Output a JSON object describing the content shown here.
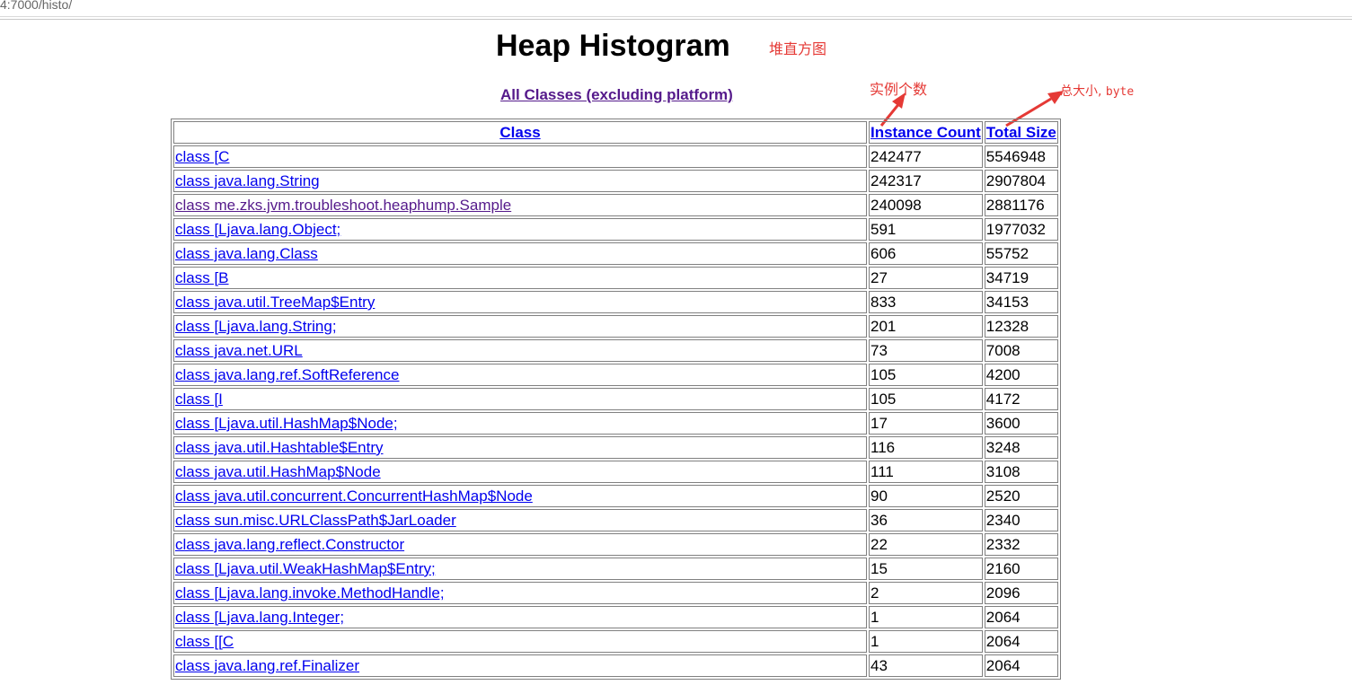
{
  "browser": {
    "url": "4:7000/histo/"
  },
  "page": {
    "title": "Heap Histogram",
    "nav_link": "All Classes (excluding platform)"
  },
  "annotations": {
    "heap_histogram_note": "堆直方图",
    "instance_count_note": "实例个数",
    "total_size_note_cn": "总大小,",
    "total_size_note_unit": "byte",
    "color": "#e53935"
  },
  "table": {
    "headers": {
      "class": "Class",
      "instance_count": "Instance Count",
      "total_size": "Total Size"
    },
    "rows": [
      {
        "class": "class [C",
        "count": "242477",
        "size": "5546948"
      },
      {
        "class": "class java.lang.String",
        "count": "242317",
        "size": "2907804"
      },
      {
        "class": "class me.zks.jvm.troubleshoot.heaphump.Sample",
        "count": "240098",
        "size": "2881176",
        "visited": true
      },
      {
        "class": "class [Ljava.lang.Object;",
        "count": "591",
        "size": "1977032"
      },
      {
        "class": "class java.lang.Class",
        "count": "606",
        "size": "55752"
      },
      {
        "class": "class [B",
        "count": "27",
        "size": "34719"
      },
      {
        "class": "class java.util.TreeMap$Entry",
        "count": "833",
        "size": "34153"
      },
      {
        "class": "class [Ljava.lang.String;",
        "count": "201",
        "size": "12328"
      },
      {
        "class": "class java.net.URL",
        "count": "73",
        "size": "7008"
      },
      {
        "class": "class java.lang.ref.SoftReference",
        "count": "105",
        "size": "4200"
      },
      {
        "class": "class [I",
        "count": "105",
        "size": "4172"
      },
      {
        "class": "class [Ljava.util.HashMap$Node;",
        "count": "17",
        "size": "3600"
      },
      {
        "class": "class java.util.Hashtable$Entry",
        "count": "116",
        "size": "3248"
      },
      {
        "class": "class java.util.HashMap$Node",
        "count": "111",
        "size": "3108"
      },
      {
        "class": "class java.util.concurrent.ConcurrentHashMap$Node",
        "count": "90",
        "size": "2520"
      },
      {
        "class": "class sun.misc.URLClassPath$JarLoader",
        "count": "36",
        "size": "2340"
      },
      {
        "class": "class java.lang.reflect.Constructor",
        "count": "22",
        "size": "2332"
      },
      {
        "class": "class [Ljava.util.WeakHashMap$Entry;",
        "count": "15",
        "size": "2160"
      },
      {
        "class": "class [Ljava.lang.invoke.MethodHandle;",
        "count": "2",
        "size": "2096"
      },
      {
        "class": "class [Ljava.lang.Integer;",
        "count": "1",
        "size": "2064"
      },
      {
        "class": "class [[C",
        "count": "1",
        "size": "2064"
      },
      {
        "class": "class java.lang.ref.Finalizer",
        "count": "43",
        "size": "2064"
      }
    ]
  }
}
